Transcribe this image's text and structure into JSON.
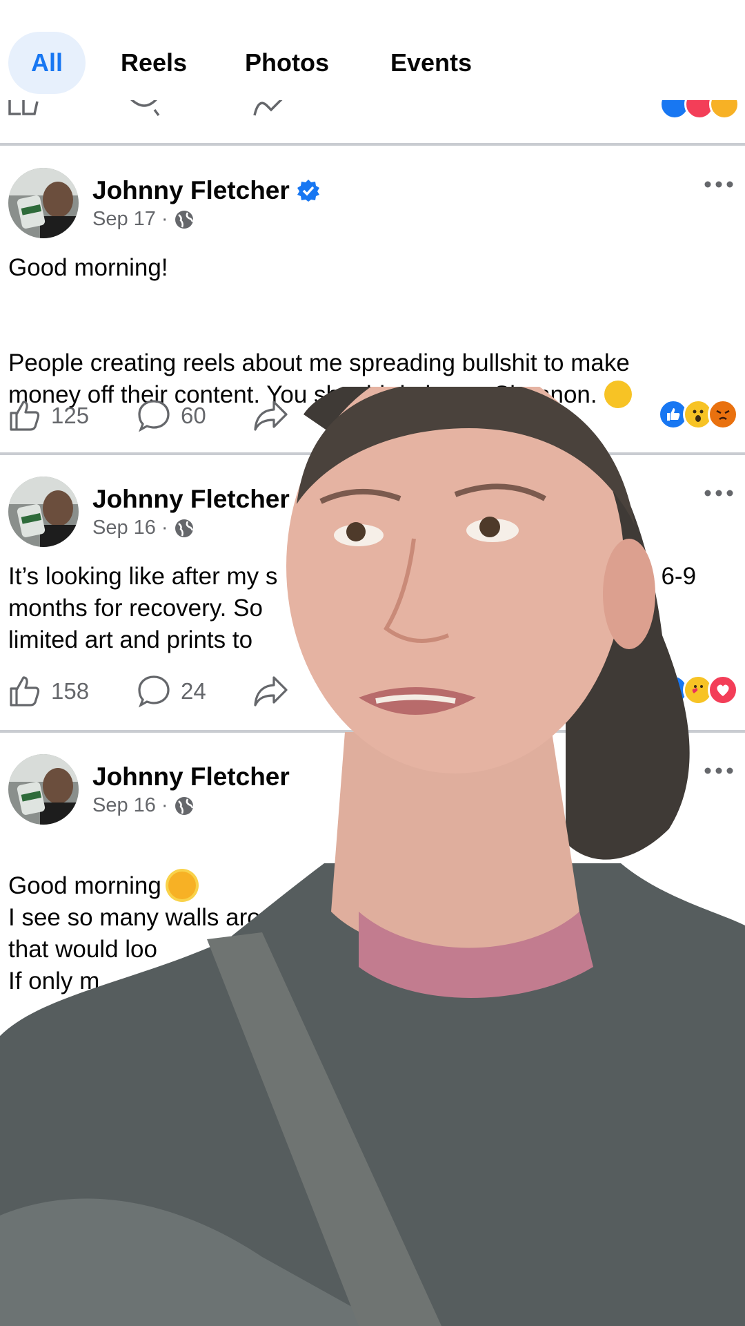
{
  "tabs": [
    {
      "label": "All",
      "active": true
    },
    {
      "label": "Reels",
      "active": false
    },
    {
      "label": "Photos",
      "active": false
    },
    {
      "label": "Events",
      "active": false
    }
  ],
  "posts": [
    {
      "author": "Johnny Fletcher",
      "date": "Sep 17",
      "separator": "·",
      "text_line1": "Good morning!",
      "text_body": "People creating reels about me spreading bullshit to make\nmoney off their content. You should do better Shannon.",
      "likes": "125",
      "comments": "60",
      "reactions": [
        "like",
        "wow",
        "angry"
      ]
    },
    {
      "author": "Johnny Fletcher",
      "date": "Sep 16",
      "separator": "·",
      "text_visible_left": "It’s looking like after my s\nmonths for recovery. So\nlimited art and prints to",
      "text_visible_right": "wn 6-9\nne",
      "likes": "158",
      "comments": "24",
      "reactions": [
        "like",
        "hug",
        "love"
      ]
    },
    {
      "author": "Johnny Fletcher",
      "date": "Sep 16",
      "separator": "·",
      "text_line1": "Good morning",
      "text_body": "I see so many walls around t\nthat would loo\nIf only m"
    }
  ],
  "colors": {
    "accent": "#1877f2",
    "tab_active_bg": "#e7f0fc",
    "divider": "#c9ccd1",
    "secondary_text": "#65676b"
  },
  "icons": [
    "verified-badge-icon",
    "globe-icon",
    "more-options-icon",
    "like-icon",
    "comment-icon",
    "share-icon"
  ]
}
